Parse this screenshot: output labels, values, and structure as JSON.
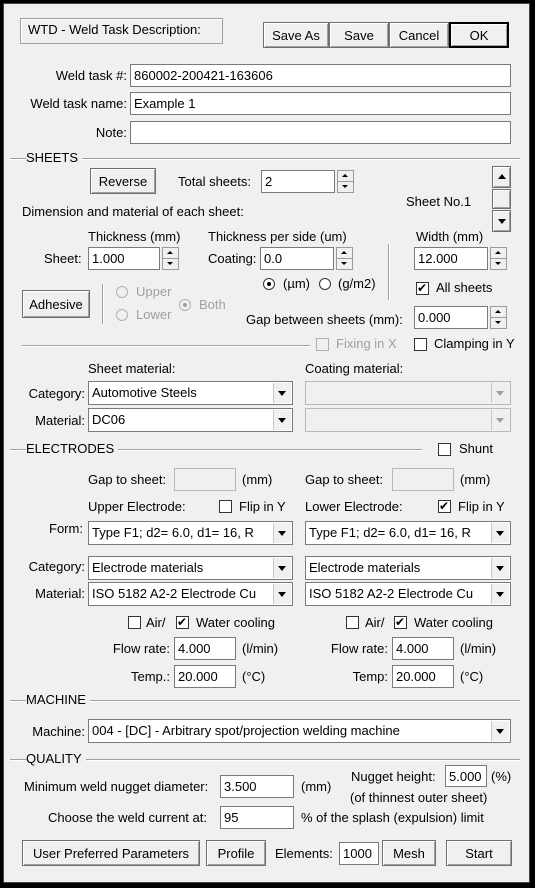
{
  "header": {
    "title": "WTD - Weld Task Description:",
    "save_as": "Save As",
    "save": "Save",
    "cancel": "Cancel",
    "ok": "OK"
  },
  "task": {
    "number_label": "Weld task #:",
    "number_value": "860002-200421-163606",
    "name_label": "Weld task name:",
    "name_value": "Example 1",
    "note_label": "Note:",
    "note_value": ""
  },
  "sheets": {
    "section": "SHEETS",
    "reverse": "Reverse",
    "total_label": "Total sheets:",
    "total_value": "2",
    "sheet_no_label": "Sheet No.1",
    "dim_label": "Dimension and material of each sheet:",
    "thickness_head": "Thickness (mm)",
    "coating_head": "Thickness per side (um)",
    "width_head": "Width (mm)",
    "sheet_label": "Sheet:",
    "thickness_value": "1.000",
    "coating_label": "Coating:",
    "coating_value": "0.0",
    "width_value": "12.000",
    "unit_um": "(µm)",
    "unit_gm2": "(g/m2)",
    "all_sheets": "All sheets",
    "adhesive": "Adhesive",
    "upper": "Upper",
    "lower": "Lower",
    "both": "Both",
    "gap_label": "Gap between sheets (mm):",
    "gap_value": "0.000",
    "fixing": "Fixing in X",
    "clamping": "Clamping in Y",
    "sheet_material_head": "Sheet material:",
    "coating_material_head": "Coating material:",
    "category_label": "Category:",
    "category_value": "Automotive Steels",
    "material_label": "Material:",
    "material_value": "DC06"
  },
  "electrodes": {
    "section": "ELECTRODES",
    "shunt": "Shunt",
    "gap_label": "Gap to sheet:",
    "mm": "(mm)",
    "upper_head": "Upper Electrode:",
    "lower_head": "Lower Electrode:",
    "flip": "Flip in Y",
    "form_label": "Form:",
    "upper_form": "Type F1;  d2= 6.0,  d1= 16,  R",
    "lower_form": "Type F1;  d2= 6.0,  d1= 16,  R",
    "category_label": "Category:",
    "upper_category": "Electrode materials",
    "lower_category": "Electrode materials",
    "material_label": "Material:",
    "upper_material": "ISO 5182  A2-2 Electrode Cu",
    "lower_material": "ISO 5182  A2-2 Electrode Cu",
    "air": "Air/",
    "water": "Water cooling",
    "flow_label": "Flow rate:",
    "upper_flow": "4.000",
    "lower_flow": "4.000",
    "flow_unit": "(l/min)",
    "temp_label": "Temp.:",
    "temp_label_lower": "Temp:",
    "upper_temp": "20.000",
    "lower_temp": "20.000",
    "temp_unit": "(°C)"
  },
  "machine": {
    "section": "MACHINE",
    "label": "Machine:",
    "value": "004 - [DC] - Arbitrary spot/projection welding machine"
  },
  "quality": {
    "section": "QUALITY",
    "nugget_label": "Minimum weld nugget diameter:",
    "nugget_value": "3.500",
    "nugget_unit": "(mm)",
    "height_label": "Nugget height:",
    "height_value": "5.000",
    "height_unit": "(%)",
    "height_note": "(of thinnest outer sheet)",
    "current_label": "Choose the weld current at:",
    "current_value": "95",
    "current_note": "% of the splash (expulsion) limit"
  },
  "footer": {
    "user_params": "User Preferred Parameters",
    "profile": "Profile",
    "elements_label": "Elements:",
    "elements_value": "1000",
    "mesh": "Mesh",
    "start": "Start"
  }
}
